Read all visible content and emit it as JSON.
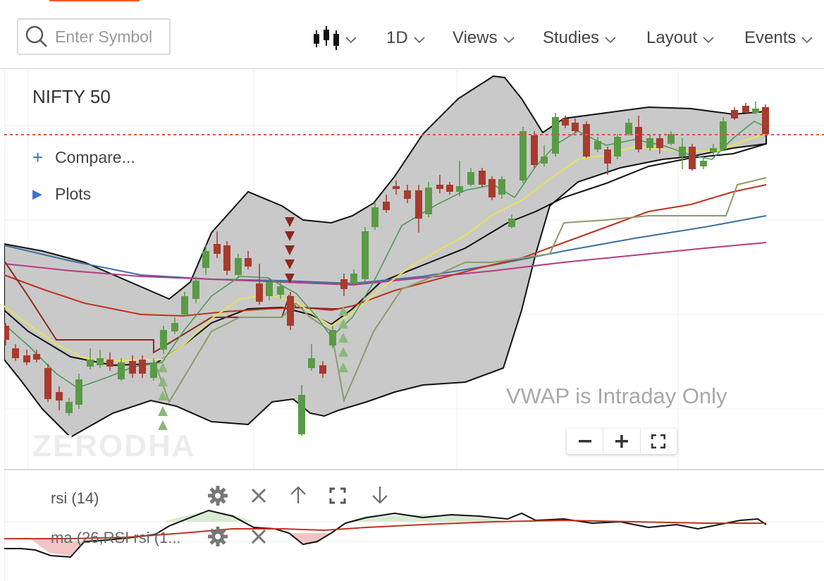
{
  "search": {
    "placeholder": "Enter Symbol",
    "icon": "search-icon"
  },
  "toolbar": {
    "chart_type_icon": "candlestick-icon",
    "interval_label": "1D",
    "views_label": "Views",
    "studies_label": "Studies",
    "layout_label": "Layout",
    "events_label": "Events"
  },
  "chart": {
    "symbol": "NIFTY 50",
    "compare_label": "Compare...",
    "plots_label": "Plots",
    "vwap_notice": "VWAP is Intraday Only",
    "watermark": "ZERODHA",
    "zoom_controls": [
      "minus-icon",
      "plus-icon",
      "fullscreen-icon"
    ]
  },
  "panels": {
    "rsi": {
      "label": "rsi (14)",
      "controls": [
        "gear-icon",
        "close-icon",
        "arrow-up-icon",
        "expand-icon",
        "arrow-down-icon"
      ]
    },
    "ma": {
      "label": "ma (26,RSI rsi (1...",
      "controls": [
        "gear-icon",
        "close-icon"
      ]
    }
  },
  "colors": {
    "bull": "#5a9a46",
    "bear": "#a83a2e",
    "band_fill": "#c8c8c8",
    "accent": "#ff5722",
    "compare_icon": "#3d6fd6"
  }
}
